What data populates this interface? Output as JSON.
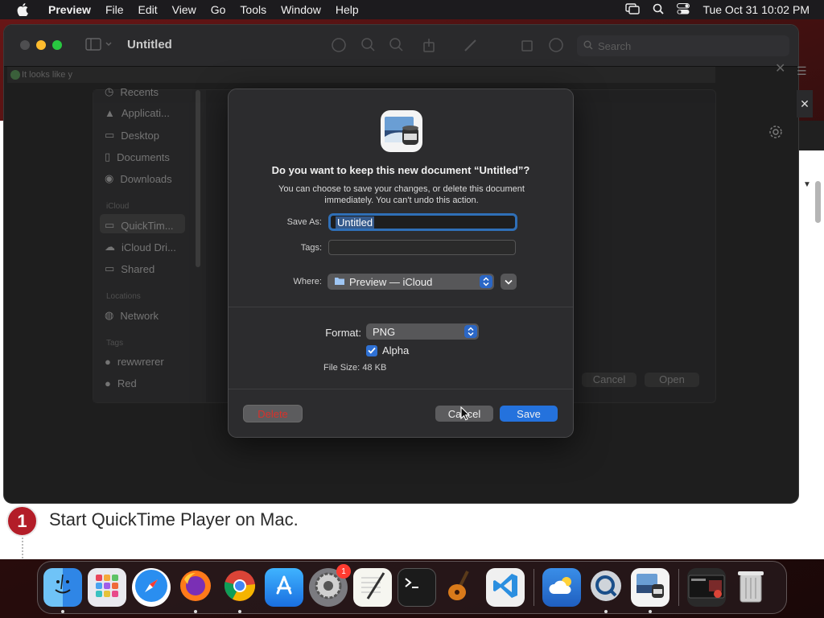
{
  "menubar": {
    "app_name": "Preview",
    "items": [
      "File",
      "Edit",
      "View",
      "Go",
      "Tools",
      "Window",
      "Help"
    ],
    "clock": "Tue Oct 31  10:02 PM"
  },
  "window": {
    "title": "Untitled",
    "search_placeholder": "Search",
    "notice": "It looks like y"
  },
  "open_panel": {
    "favorites": [
      "Recents",
      "Applicati...",
      "Desktop",
      "Documents",
      "Downloads"
    ],
    "icloud_heading": "iCloud",
    "icloud_items": [
      "QuickTim...",
      "iCloud Dri...",
      "Shared"
    ],
    "locations_heading": "Locations",
    "locations_items": [
      "Network"
    ],
    "tags_heading": "Tags",
    "tags_items": [
      "rewwrerer",
      "Red"
    ],
    "cancel_label": "Cancel",
    "open_label": "Open"
  },
  "dialog": {
    "title": "Do you want to keep this new document “Untitled”?",
    "message": "You can choose to save your changes, or delete this document immediately. You can't undo this action.",
    "save_as_label": "Save As:",
    "save_as_value": "Untitled",
    "tags_label": "Tags:",
    "where_label": "Where:",
    "where_value": "Preview — iCloud",
    "format_label": "Format:",
    "format_value": "PNG",
    "alpha_label": "Alpha",
    "alpha_checked": true,
    "file_size_label": "File Size:",
    "file_size_value": "48 KB",
    "delete_label": "Delete",
    "cancel_label": "Cancel",
    "save_label": "Save"
  },
  "webpage": {
    "step_number": "1",
    "step_text": "Start QuickTime Player on Mac."
  },
  "dock": {
    "apps": [
      "Finder",
      "Launchpad",
      "Safari",
      "Firefox",
      "Chrome",
      "App Store",
      "System Settings",
      "TextEdit",
      "Terminal",
      "GarageBand",
      "Visual Studio Code",
      "iCloud",
      "QuickTime Player",
      "Preview",
      "Window Preview",
      "Trash"
    ],
    "settings_badge": "1"
  },
  "colors": {
    "accent": "#2472dd",
    "destructive": "#d8312b",
    "badge": "#ff3b30"
  }
}
